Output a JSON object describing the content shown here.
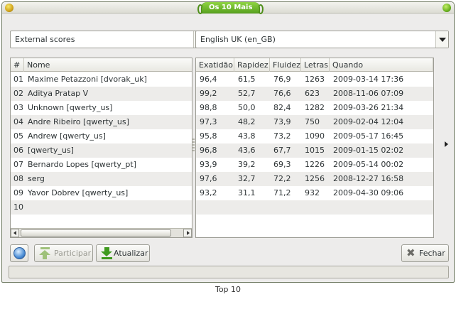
{
  "window": {
    "title": "Os 10 Mais",
    "caption": "Top 10"
  },
  "selectors": {
    "source": "External scores",
    "language": "English UK (en_GB)"
  },
  "table": {
    "columns_left": [
      "#",
      "Nome"
    ],
    "columns_right": [
      "Exatidão",
      "Rapidez",
      "Fluidez",
      "Letras",
      "Quando"
    ],
    "rows": [
      {
        "rank": "01",
        "name": "Maxime Petazzoni [dvorak_uk]",
        "exatidao": "96,4",
        "rapidez": "61,5",
        "fluidez": "76,9",
        "letras": "1263",
        "quando": "2009-03-14 17:36"
      },
      {
        "rank": "02",
        "name": "Aditya Pratap V",
        "exatidao": "99,2",
        "rapidez": "52,7",
        "fluidez": "76,6",
        "letras": "623",
        "quando": "2008-11-06 07:09"
      },
      {
        "rank": "03",
        "name": "Unknown [qwerty_us]",
        "exatidao": "98,8",
        "rapidez": "50,0",
        "fluidez": "82,4",
        "letras": "1282",
        "quando": "2009-03-26 21:34"
      },
      {
        "rank": "04",
        "name": "Andre Ribeiro [qwerty_us]",
        "exatidao": "97,3",
        "rapidez": "48,2",
        "fluidez": "73,9",
        "letras": "750",
        "quando": "2009-02-04 12:04"
      },
      {
        "rank": "05",
        "name": "Andrew [qwerty_us]",
        "exatidao": "95,8",
        "rapidez": "43,8",
        "fluidez": "73,2",
        "letras": "1090",
        "quando": "2009-05-17 16:45"
      },
      {
        "rank": "06",
        "name": "[qwerty_us]",
        "exatidao": "96,8",
        "rapidez": "43,6",
        "fluidez": "67,7",
        "letras": "1015",
        "quando": "2009-01-15 02:02"
      },
      {
        "rank": "07",
        "name": "Bernardo Lopes [qwerty_pt]",
        "exatidao": "93,9",
        "rapidez": "39,2",
        "fluidez": "69,3",
        "letras": "1226",
        "quando": "2009-05-14 00:02"
      },
      {
        "rank": "08",
        "name": "serg",
        "exatidao": "97,6",
        "rapidez": "32,7",
        "fluidez": "72,2",
        "letras": "1256",
        "quando": "2008-12-27 16:58"
      },
      {
        "rank": "09",
        "name": "Yavor Dobrev [qwerty_us]",
        "exatidao": "93,2",
        "rapidez": "31,1",
        "fluidez": "71,2",
        "letras": "932",
        "quando": "2009-04-30 09:06"
      },
      {
        "rank": "10",
        "name": "",
        "exatidao": "",
        "rapidez": "",
        "fluidez": "",
        "letras": "",
        "quando": ""
      }
    ]
  },
  "buttons": {
    "participar": "Participar",
    "atualizar": "Atualizar",
    "fechar": "Fechar"
  },
  "icons": {
    "menu": "window-menu-icon",
    "close": "window-close-icon",
    "globe": "globe-icon",
    "participar": "upload-arrow-icon",
    "atualizar": "download-arrow-icon",
    "fechar": "close-x-icon"
  },
  "colors": {
    "title_accent": "#6bb82a",
    "row_alt": "#edecea"
  }
}
